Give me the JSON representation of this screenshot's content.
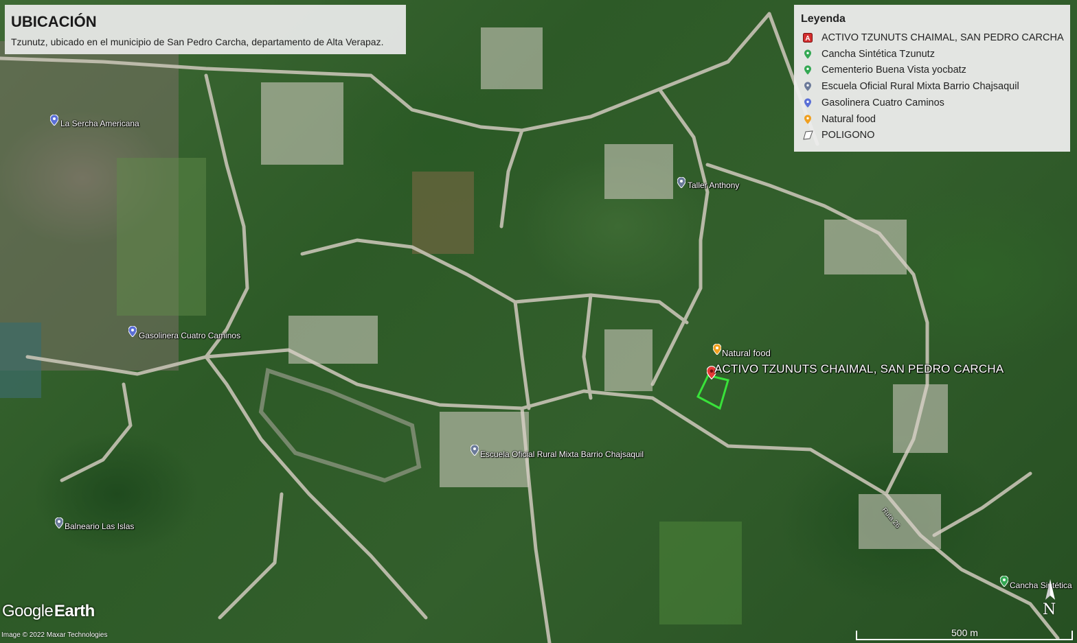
{
  "header": {
    "title": "UBICACIÓN",
    "subtitle": "Tzunutz, ubicado en el municipio de San Pedro Carcha, departamento de Alta Verapaz."
  },
  "legend": {
    "title": "Leyenda",
    "items": [
      {
        "label": "ACTIVO TZUNUTS CHAIMAL, SAN PEDRO CARCHA",
        "icon": "placemark-a-icon",
        "color": "#d32f2f"
      },
      {
        "label": "Cancha Sintética Tzunutz",
        "icon": "green-pin-icon",
        "color": "#34a853"
      },
      {
        "label": "Cementerio Buena Vista yocbatz",
        "icon": "green-pin-icon",
        "color": "#34a853"
      },
      {
        "label": "Escuela Oficial Rural Mixta Barrio Chajsaquil",
        "icon": "gray-blue-pin-icon",
        "color": "#6b7a99"
      },
      {
        "label": "Gasolinera Cuatro Caminos",
        "icon": "blue-pin-icon",
        "color": "#5b6fd6"
      },
      {
        "label": "Natural food",
        "icon": "orange-pin-icon",
        "color": "#f0a020"
      },
      {
        "label": "POLIGONO",
        "icon": "polygon-icon",
        "color": "#ffffff"
      }
    ]
  },
  "map_labels": {
    "la_sercha": "La Sercha Americana",
    "taller": "Taller Anthony",
    "gasolinera": "Gasolinera Cuatro Caminos",
    "natural_food": "Natural food",
    "activo": "ACTIVO TZUNUTS CHAIMAL, SAN PEDRO CARCHA",
    "escuela": "Escuela Oficial Rural Mixta Barrio Chajsaquil",
    "balneario": "Balneario Las Islas",
    "cancha": "Cancha Sintética",
    "road": "Ruta 26"
  },
  "footer": {
    "brand_light": "Google",
    "brand_bold": "Earth",
    "imagery": "Image © 2022 Maxar Technologies",
    "scale": "500 m",
    "north": "N"
  },
  "colors": {
    "polygon": "#39e23a",
    "target_pin": "#e53935"
  }
}
